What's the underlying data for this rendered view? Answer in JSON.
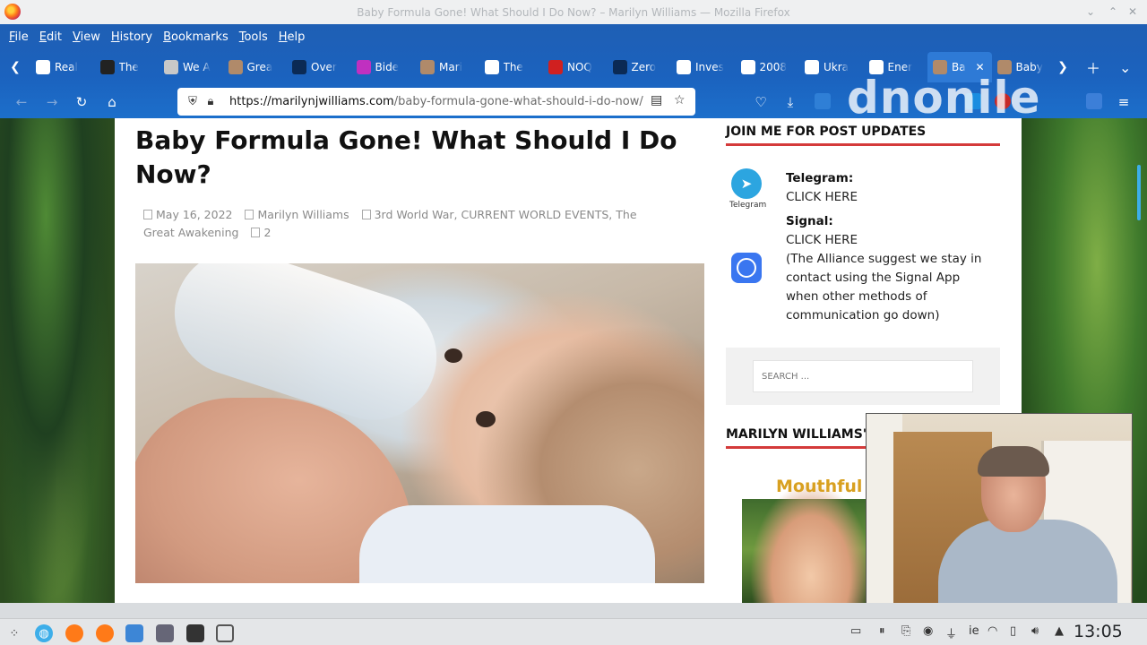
{
  "window": {
    "title": "Baby Formula Gone! What Should I Do Now? – Marilyn Williams — Mozilla Firefox"
  },
  "menu": [
    "File",
    "Edit",
    "View",
    "History",
    "Bookmarks",
    "Tools",
    "Help"
  ],
  "tabs": [
    {
      "label": "Real",
      "color": "#ffffff"
    },
    {
      "label": "The",
      "color": "#222222"
    },
    {
      "label": "We A",
      "color": "#c8c8c8"
    },
    {
      "label": "Grea",
      "color": "#b08a6a"
    },
    {
      "label": "Over",
      "color": "#0b2a55"
    },
    {
      "label": "Bide",
      "color": "#c030c0"
    },
    {
      "label": "Mari",
      "color": "#b08a6a"
    },
    {
      "label": "The",
      "color": "#ffffff"
    },
    {
      "label": "NOQ",
      "color": "#d02020"
    },
    {
      "label": "Zero",
      "color": "#0b2a55"
    },
    {
      "label": "Inves",
      "color": "#ffffff"
    },
    {
      "label": "2008",
      "color": "#ffffff"
    },
    {
      "label": "Ukra",
      "color": "#ffffff"
    },
    {
      "label": "Ener",
      "color": "#ffffff"
    },
    {
      "label": "Ba",
      "color": "#b08a6a",
      "active": true
    },
    {
      "label": "Baby",
      "color": "#b08a6a"
    }
  ],
  "urlbar": {
    "host": "https://marilynjwilliams.com",
    "path": "/baby-formula-gone-what-should-i-do-now/"
  },
  "overlay_logo": "dnonile",
  "article": {
    "title": "Baby Formula Gone! What Should I Do Now?",
    "date": "May 16, 2022",
    "author": "Marilyn Williams",
    "categories": "3rd World War, CURRENT WORLD EVENTS, The Great Awakening",
    "comments": "2"
  },
  "sidebar": {
    "join_heading": "JOIN ME FOR POST UPDATES",
    "telegram_caption": "Telegram",
    "telegram_label": "Telegram:",
    "telegram_link": "CLICK HERE",
    "signal_label": "Signal:",
    "signal_link": "CLICK HERE",
    "signal_note": "(The Alliance suggest we stay in contact using the Signal App when other methods of communication go down)",
    "search_placeholder": "SEARCH ...",
    "williams_heading": "MARILYN WILLIAMS'",
    "book_title": "Mouthful"
  },
  "taskbar": {
    "keyboard_layout": "ie",
    "time": "13:05"
  },
  "colors": {
    "chrome_blue": "#1b62be",
    "accent_red": "#d43a3a",
    "telegram": "#2ca5e0",
    "signal": "#3a76f0"
  }
}
